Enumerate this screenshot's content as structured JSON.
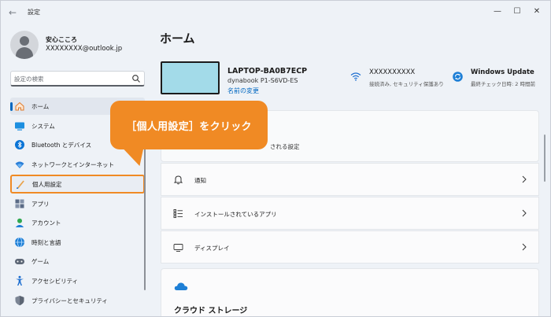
{
  "window": {
    "title": "設定",
    "back_glyph": "←",
    "min_glyph": "—",
    "max_glyph": "☐",
    "close_glyph": "✕"
  },
  "profile": {
    "name": "安心こころ",
    "email": "XXXXXXXX@outlook.jp"
  },
  "search": {
    "placeholder": "設定の検索",
    "icon": "search-icon"
  },
  "sidebar": {
    "items": [
      {
        "label": "ホーム",
        "icon": "home-icon"
      },
      {
        "label": "システム",
        "icon": "system-icon"
      },
      {
        "label": "Bluetooth とデバイス",
        "icon": "bluetooth-icon"
      },
      {
        "label": "ネットワークとインターネット",
        "icon": "network-icon"
      },
      {
        "label": "個人用設定",
        "icon": "brush-icon"
      },
      {
        "label": "アプリ",
        "icon": "apps-icon"
      },
      {
        "label": "アカウント",
        "icon": "account-icon"
      },
      {
        "label": "時刻と言語",
        "icon": "time-language-icon"
      },
      {
        "label": "ゲーム",
        "icon": "gamepad-icon"
      },
      {
        "label": "アクセシビリティ",
        "icon": "accessibility-icon"
      },
      {
        "label": "プライバシーとセキュリティ",
        "icon": "shield-icon"
      }
    ],
    "active_index": 0,
    "highlight_index": 4
  },
  "main": {
    "title": "ホーム",
    "device": {
      "name": "LAPTOP-BA0B7ECP",
      "model": "dynabook P1-S6VD-ES",
      "rename": "名前の変更"
    },
    "wifi": {
      "name": "XXXXXXXXXX",
      "status": "接続済み, セキュリティ保護あり"
    },
    "update": {
      "title": "Windows Update",
      "status": "最終チェック日時: 2 時間前"
    },
    "recommended_subtitle": "される設定",
    "rows": [
      {
        "label": "通知",
        "icon": "bell-icon"
      },
      {
        "label": "インストールされているアプリ",
        "icon": "list-icon"
      },
      {
        "label": "ディスプレイ",
        "icon": "display-icon"
      }
    ],
    "cloud_title": "クラウド ストレージ"
  },
  "callout": {
    "text": "［個人用設定］をクリック"
  },
  "colors": {
    "accent": "#0067c0",
    "callout": "#f08a24"
  }
}
